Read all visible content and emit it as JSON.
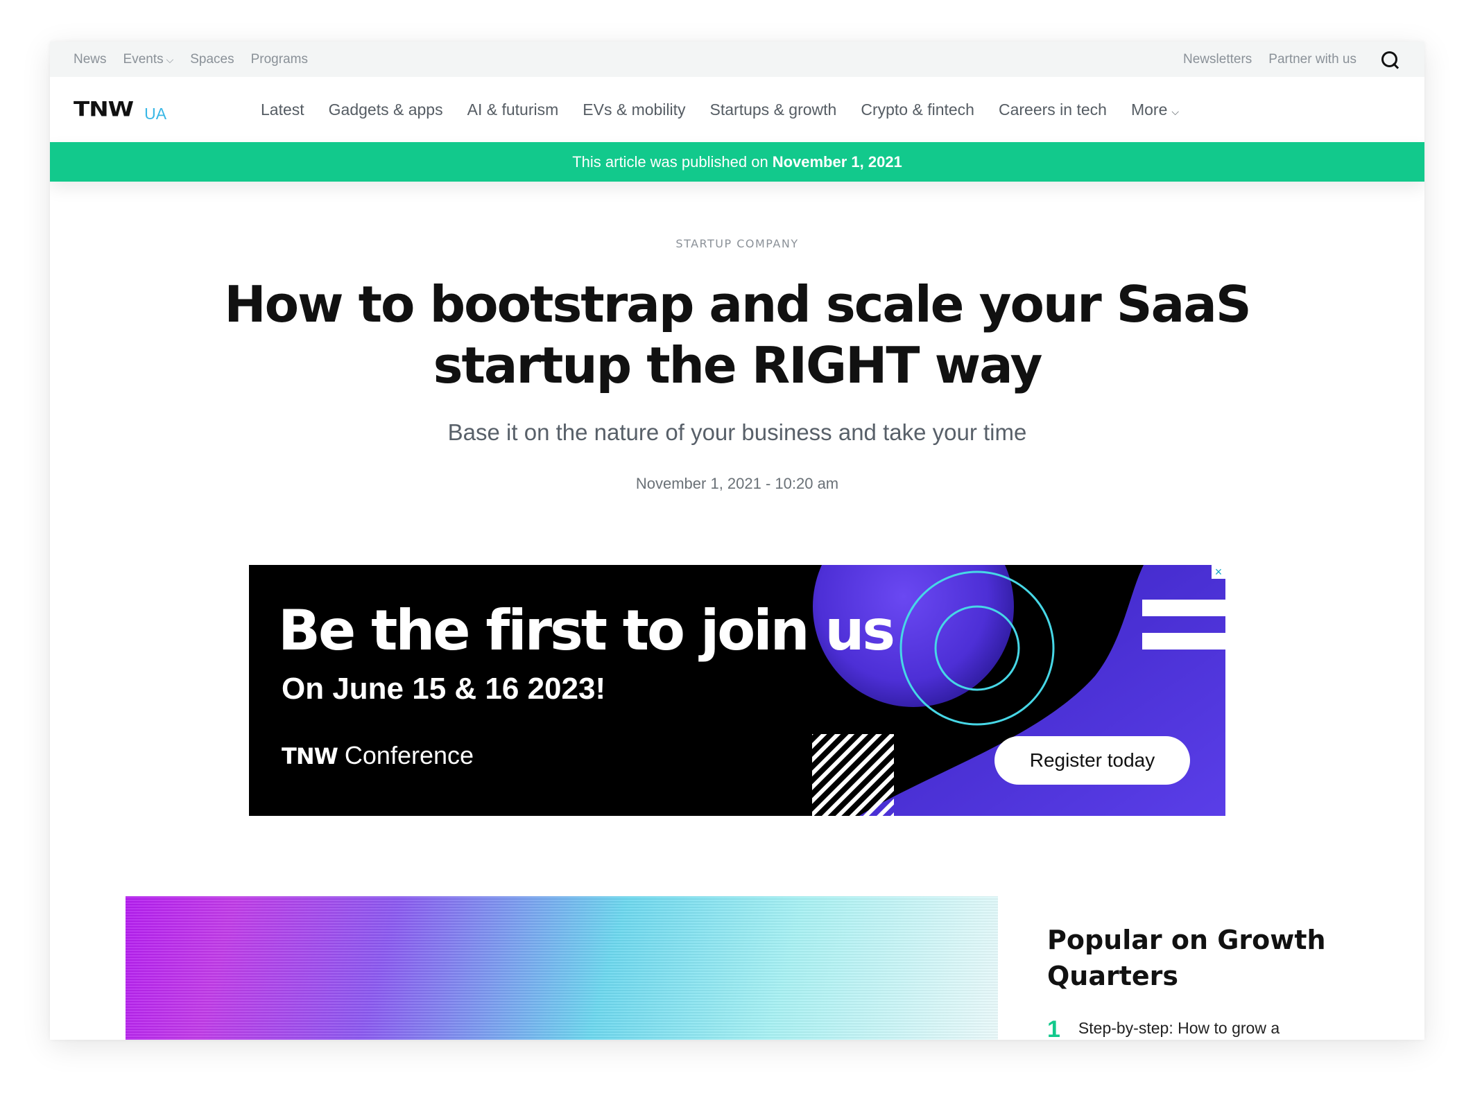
{
  "topbar": {
    "left": [
      "News",
      "Events",
      "Spaces",
      "Programs"
    ],
    "right": [
      "Newsletters",
      "Partner with us"
    ]
  },
  "nav": {
    "logo": "TNW",
    "edition": "UA",
    "links": [
      "Latest",
      "Gadgets & apps",
      "AI & futurism",
      "EVs & mobility",
      "Startups & growth",
      "Crypto & fintech",
      "Careers in tech",
      "More"
    ]
  },
  "banner": {
    "prefix": "This article was published on",
    "date": "November 1, 2021"
  },
  "article": {
    "category": "STARTUP COMPANY",
    "title": "How to bootstrap and scale your SaaS startup the RIGHT way",
    "subtitle": "Base it on the nature of your business and take your time",
    "datetime": "November 1, 2021 - 10:20 am"
  },
  "ad": {
    "headline": "Be the first to join us",
    "date": "On June 15 & 16 2023!",
    "brand_logo": "TNW",
    "brand_text": "Conference",
    "cta": "Register today",
    "close": "×"
  },
  "sidebar": {
    "title": "Popular on Growth Quarters",
    "items": [
      {
        "num": "1",
        "text": "Step-by-step: How to grow a"
      }
    ]
  },
  "colors": {
    "accent": "#12c98c",
    "edition": "#39b7e6",
    "ad_purple": "#5b3fe6"
  }
}
